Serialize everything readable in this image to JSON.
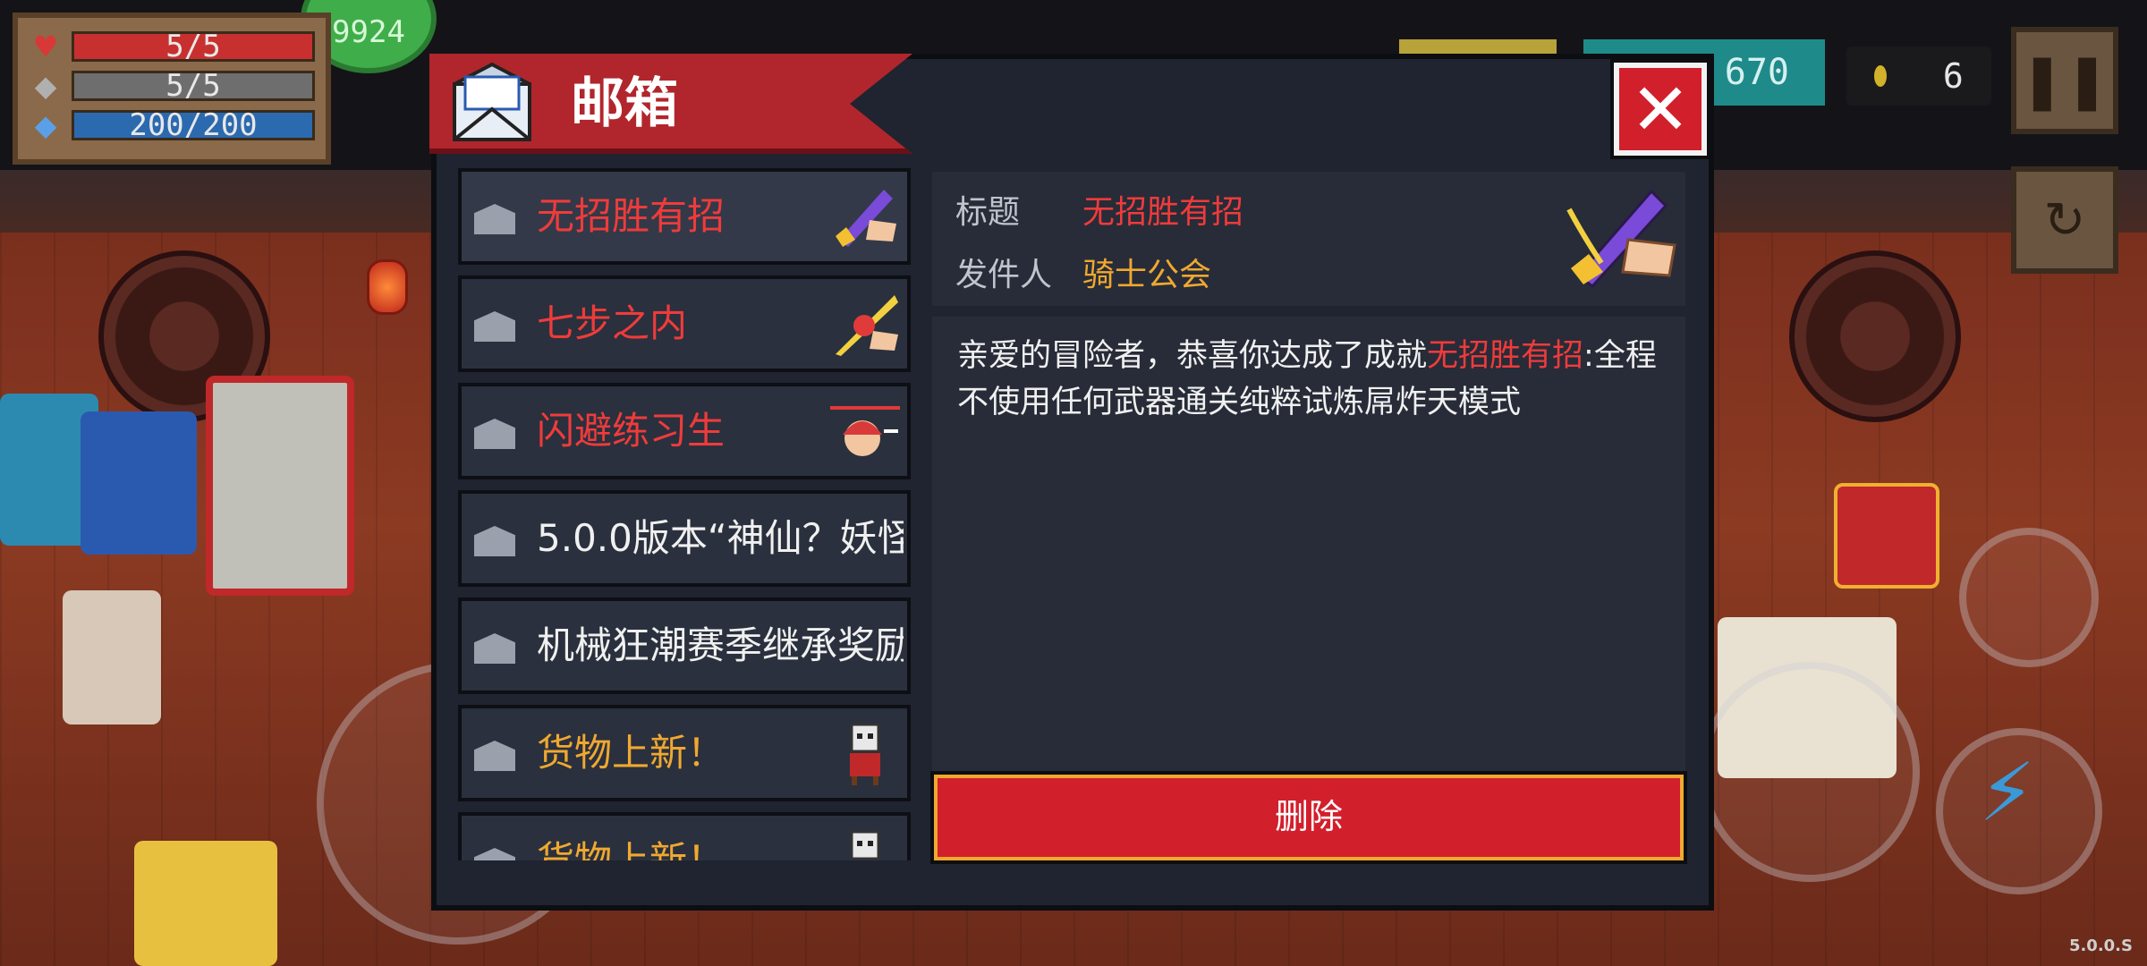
{
  "hud": {
    "hp": "5/5",
    "armor": "5/5",
    "energy": "200/200",
    "green_coin": "9924",
    "gems": "670",
    "coins": "6",
    "version": "5.0.0.S"
  },
  "mailbox": {
    "title": "邮箱",
    "close_icon": "close-icon",
    "items": [
      {
        "label": "无招胜有招",
        "color": "#ef3b3b",
        "icon": "sword-hand-icon",
        "selected": true
      },
      {
        "label": "七步之内",
        "color": "#ef3b3b",
        "icon": "slash-icon",
        "selected": false
      },
      {
        "label": "闪避练习生",
        "color": "#ef3b3b",
        "icon": "character-icon",
        "selected": false
      },
      {
        "label": "5.0.0版本“神仙？妖怪",
        "color": "#f0f0f0",
        "icon": "",
        "selected": false
      },
      {
        "label": "机械狂潮赛季继承奖励",
        "color": "#f0f0f0",
        "icon": "",
        "selected": false
      },
      {
        "label": "货物上新！",
        "color": "#f0a830",
        "icon": "merchant-icon",
        "selected": false
      },
      {
        "label": "货物上新！",
        "color": "#f0a830",
        "icon": "merchant-icon",
        "selected": false
      }
    ],
    "detail": {
      "subject_label": "标题",
      "subject": "无招胜有招",
      "sender_label": "发件人",
      "sender": "骑士公会",
      "body_before": "亲爱的冒险者，恭喜你达成了成就",
      "body_highlight": "无招胜有招",
      "body_after": ":全程不使用任何武器通关纯粹试炼屌炸天模式",
      "delete_label": "删除"
    }
  }
}
